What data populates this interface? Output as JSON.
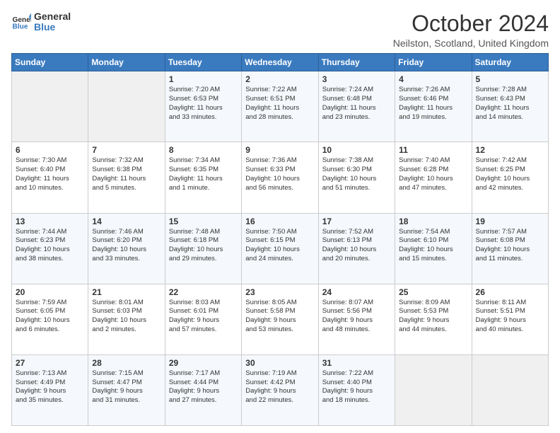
{
  "logo": {
    "line1": "General",
    "line2": "Blue"
  },
  "title": "October 2024",
  "location": "Neilston, Scotland, United Kingdom",
  "days_header": [
    "Sunday",
    "Monday",
    "Tuesday",
    "Wednesday",
    "Thursday",
    "Friday",
    "Saturday"
  ],
  "weeks": [
    [
      {
        "day": "",
        "text": ""
      },
      {
        "day": "",
        "text": ""
      },
      {
        "day": "1",
        "text": "Sunrise: 7:20 AM\nSunset: 6:53 PM\nDaylight: 11 hours\nand 33 minutes."
      },
      {
        "day": "2",
        "text": "Sunrise: 7:22 AM\nSunset: 6:51 PM\nDaylight: 11 hours\nand 28 minutes."
      },
      {
        "day": "3",
        "text": "Sunrise: 7:24 AM\nSunset: 6:48 PM\nDaylight: 11 hours\nand 23 minutes."
      },
      {
        "day": "4",
        "text": "Sunrise: 7:26 AM\nSunset: 6:46 PM\nDaylight: 11 hours\nand 19 minutes."
      },
      {
        "day": "5",
        "text": "Sunrise: 7:28 AM\nSunset: 6:43 PM\nDaylight: 11 hours\nand 14 minutes."
      }
    ],
    [
      {
        "day": "6",
        "text": "Sunrise: 7:30 AM\nSunset: 6:40 PM\nDaylight: 11 hours\nand 10 minutes."
      },
      {
        "day": "7",
        "text": "Sunrise: 7:32 AM\nSunset: 6:38 PM\nDaylight: 11 hours\nand 5 minutes."
      },
      {
        "day": "8",
        "text": "Sunrise: 7:34 AM\nSunset: 6:35 PM\nDaylight: 11 hours\nand 1 minute."
      },
      {
        "day": "9",
        "text": "Sunrise: 7:36 AM\nSunset: 6:33 PM\nDaylight: 10 hours\nand 56 minutes."
      },
      {
        "day": "10",
        "text": "Sunrise: 7:38 AM\nSunset: 6:30 PM\nDaylight: 10 hours\nand 51 minutes."
      },
      {
        "day": "11",
        "text": "Sunrise: 7:40 AM\nSunset: 6:28 PM\nDaylight: 10 hours\nand 47 minutes."
      },
      {
        "day": "12",
        "text": "Sunrise: 7:42 AM\nSunset: 6:25 PM\nDaylight: 10 hours\nand 42 minutes."
      }
    ],
    [
      {
        "day": "13",
        "text": "Sunrise: 7:44 AM\nSunset: 6:23 PM\nDaylight: 10 hours\nand 38 minutes."
      },
      {
        "day": "14",
        "text": "Sunrise: 7:46 AM\nSunset: 6:20 PM\nDaylight: 10 hours\nand 33 minutes."
      },
      {
        "day": "15",
        "text": "Sunrise: 7:48 AM\nSunset: 6:18 PM\nDaylight: 10 hours\nand 29 minutes."
      },
      {
        "day": "16",
        "text": "Sunrise: 7:50 AM\nSunset: 6:15 PM\nDaylight: 10 hours\nand 24 minutes."
      },
      {
        "day": "17",
        "text": "Sunrise: 7:52 AM\nSunset: 6:13 PM\nDaylight: 10 hours\nand 20 minutes."
      },
      {
        "day": "18",
        "text": "Sunrise: 7:54 AM\nSunset: 6:10 PM\nDaylight: 10 hours\nand 15 minutes."
      },
      {
        "day": "19",
        "text": "Sunrise: 7:57 AM\nSunset: 6:08 PM\nDaylight: 10 hours\nand 11 minutes."
      }
    ],
    [
      {
        "day": "20",
        "text": "Sunrise: 7:59 AM\nSunset: 6:05 PM\nDaylight: 10 hours\nand 6 minutes."
      },
      {
        "day": "21",
        "text": "Sunrise: 8:01 AM\nSunset: 6:03 PM\nDaylight: 10 hours\nand 2 minutes."
      },
      {
        "day": "22",
        "text": "Sunrise: 8:03 AM\nSunset: 6:01 PM\nDaylight: 9 hours\nand 57 minutes."
      },
      {
        "day": "23",
        "text": "Sunrise: 8:05 AM\nSunset: 5:58 PM\nDaylight: 9 hours\nand 53 minutes."
      },
      {
        "day": "24",
        "text": "Sunrise: 8:07 AM\nSunset: 5:56 PM\nDaylight: 9 hours\nand 48 minutes."
      },
      {
        "day": "25",
        "text": "Sunrise: 8:09 AM\nSunset: 5:53 PM\nDaylight: 9 hours\nand 44 minutes."
      },
      {
        "day": "26",
        "text": "Sunrise: 8:11 AM\nSunset: 5:51 PM\nDaylight: 9 hours\nand 40 minutes."
      }
    ],
    [
      {
        "day": "27",
        "text": "Sunrise: 7:13 AM\nSunset: 4:49 PM\nDaylight: 9 hours\nand 35 minutes."
      },
      {
        "day": "28",
        "text": "Sunrise: 7:15 AM\nSunset: 4:47 PM\nDaylight: 9 hours\nand 31 minutes."
      },
      {
        "day": "29",
        "text": "Sunrise: 7:17 AM\nSunset: 4:44 PM\nDaylight: 9 hours\nand 27 minutes."
      },
      {
        "day": "30",
        "text": "Sunrise: 7:19 AM\nSunset: 4:42 PM\nDaylight: 9 hours\nand 22 minutes."
      },
      {
        "day": "31",
        "text": "Sunrise: 7:22 AM\nSunset: 4:40 PM\nDaylight: 9 hours\nand 18 minutes."
      },
      {
        "day": "",
        "text": ""
      },
      {
        "day": "",
        "text": ""
      }
    ]
  ]
}
